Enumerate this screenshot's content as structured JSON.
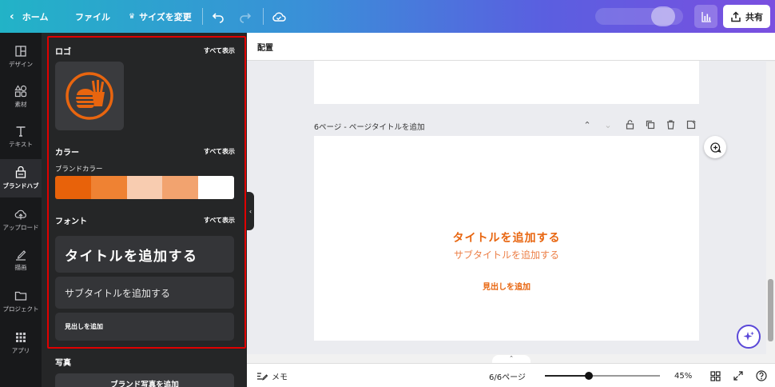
{
  "topbar": {
    "home": "ホーム",
    "file": "ファイル",
    "resize": "サイズを変更",
    "share": "共有"
  },
  "rail": [
    {
      "label": "デザイン",
      "icon": "layout-icon"
    },
    {
      "label": "素材",
      "icon": "shapes-icon"
    },
    {
      "label": "テキスト",
      "icon": "text-icon"
    },
    {
      "label": "ブランドハブ",
      "icon": "brand-hub-icon",
      "active": true
    },
    {
      "label": "アップロード",
      "icon": "upload-cloud-icon"
    },
    {
      "label": "描画",
      "icon": "draw-pen-icon"
    },
    {
      "label": "プロジェクト",
      "icon": "folder-icon"
    },
    {
      "label": "アプリ",
      "icon": "apps-grid-icon"
    }
  ],
  "panel": {
    "logo": {
      "title": "ロゴ",
      "see_all": "すべて表示"
    },
    "color": {
      "title": "カラー",
      "see_all": "すべて表示",
      "brand_label": "ブランドカラー",
      "swatches": [
        "#e8620a",
        "#ef8233",
        "#f8ccb0",
        "#f2a36f",
        "#ffffff"
      ]
    },
    "font": {
      "title": "フォント",
      "see_all": "すべて表示",
      "title_text": "タイトルを追加する",
      "subtitle_text": "サブタイトルを追加する",
      "heading_text": "見出しを追加"
    },
    "photo": {
      "title": "写真",
      "button": "ブランド写真を追加"
    }
  },
  "canvas": {
    "context_label": "配置",
    "page_label": "6ページ - ページタイトルを追加",
    "page_title": "タイトルを追加する",
    "page_subtitle": "サブタイトルを追加する",
    "page_heading": "見出しを追加"
  },
  "bottom": {
    "memo": "メモ",
    "page_count": "6/6ページ",
    "zoom": "45%",
    "zoom_fraction": 0.38
  },
  "colors": {
    "accent": "#e8650f",
    "highlight": "#e00000"
  }
}
